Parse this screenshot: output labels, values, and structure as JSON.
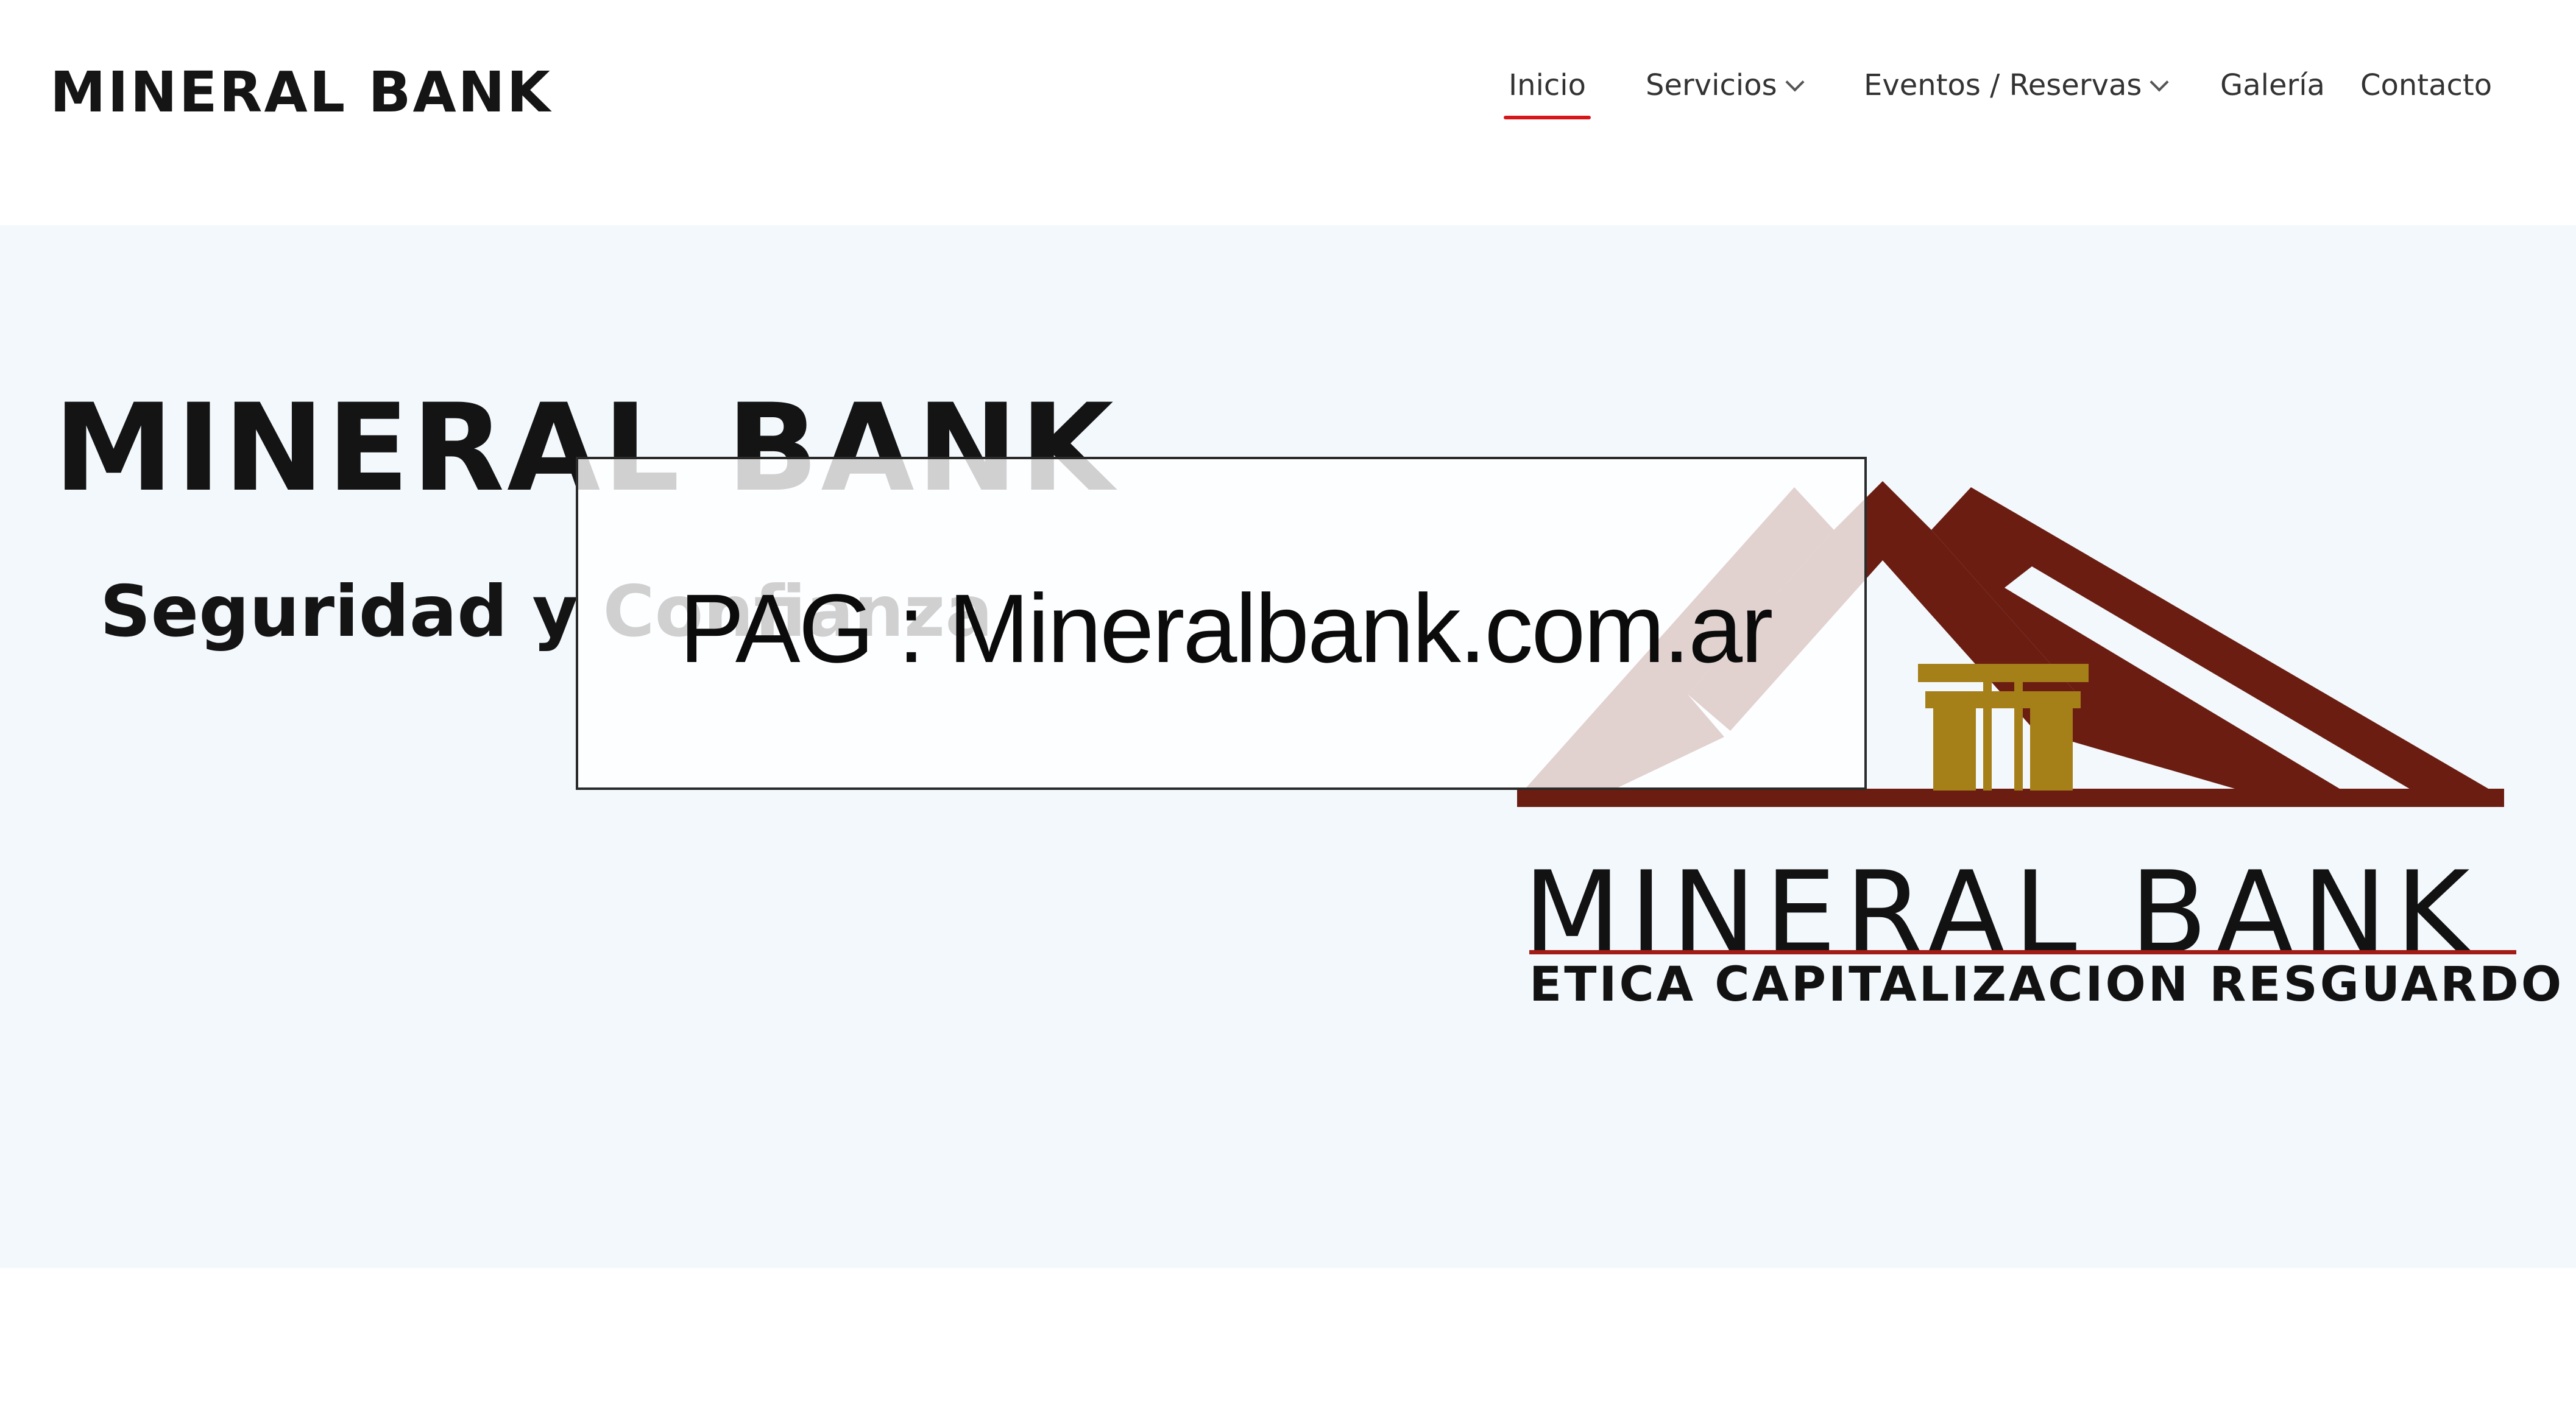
{
  "header": {
    "brand": "MINERAL BANK",
    "nav": [
      {
        "label": "Inicio",
        "active": true,
        "has_dropdown": false
      },
      {
        "label": "Servicios",
        "active": false,
        "has_dropdown": true
      },
      {
        "label": "Eventos / Reservas",
        "active": false,
        "has_dropdown": true
      },
      {
        "label": "Galería",
        "active": false,
        "has_dropdown": false
      },
      {
        "label": "Contacto",
        "active": false,
        "has_dropdown": false
      }
    ],
    "active_underline_color": "#d8151a"
  },
  "hero": {
    "title": "MINERAL BANK",
    "subtitle": "Seguridad y Confianza",
    "background_color": "#f2f8fc"
  },
  "logo": {
    "name": "MINERAL BANK",
    "tagline": "ETICA CAPITALIZACION RESGUARDO",
    "roof_color": "#6b1d12",
    "pillar_color": "#a57f18",
    "rule_color": "#a21b16"
  },
  "overlay": {
    "text": "PAG : Mineralbank.com.ar"
  }
}
